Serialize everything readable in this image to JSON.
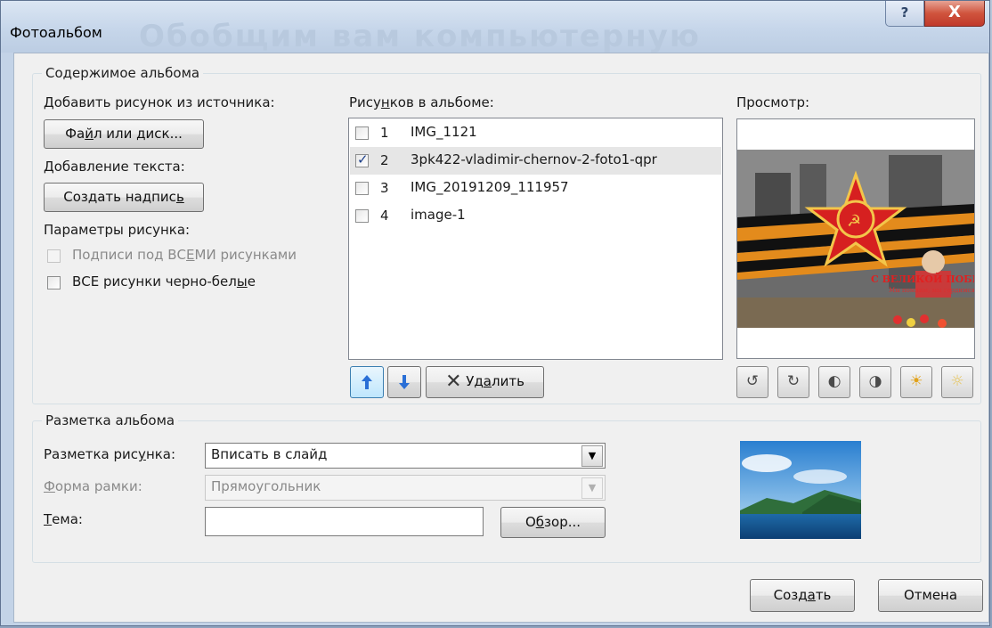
{
  "window": {
    "title": "Фотоальбом",
    "watermark": "Обобщим вам компьютерную",
    "help_label": "?",
    "close_label": "X"
  },
  "content_group": {
    "legend": "Содержимое альбома",
    "add_from_source_label": "Добавить рисунок из источника:",
    "file_button": {
      "pre": "Фа",
      "u": "й",
      "post": "л или диск..."
    },
    "add_text_label": "Добавление текста:",
    "textbox_button": {
      "pre": "Создать надпис",
      "u": "ь",
      "post": ""
    },
    "picture_options_label": "Параметры рисунка:",
    "captions_checkbox": {
      "pre": "Подписи под ВС",
      "u": "Е",
      "post": "МИ рисунками",
      "checked": false,
      "enabled": false
    },
    "bw_checkbox": {
      "pre": "ВСЕ рисунки черно-бел",
      "u": "ы",
      "post": "е",
      "checked": false,
      "enabled": true
    }
  },
  "pictures": {
    "label": {
      "pre": "Рису",
      "u": "н",
      "post": "ков в альбоме:"
    },
    "items": [
      {
        "num": "1",
        "name": "IMG_1121",
        "checked": false
      },
      {
        "num": "2",
        "name": "3pk422-vladimir-chernov-2-foto1-qpr",
        "checked": true
      },
      {
        "num": "3",
        "name": "IMG_20191209_111957",
        "checked": false
      },
      {
        "num": "4",
        "name": "image-1",
        "checked": false
      }
    ],
    "up_icon": "arrow-up-icon",
    "down_icon": "arrow-down-icon",
    "delete_button": {
      "pre": "Уд",
      "u": "а",
      "post": "лить"
    }
  },
  "preview": {
    "label": "Просмотр:",
    "banner_text": "С ВЕЛИКОЙ ПОБЕДОЙ!",
    "banner_subtext": "Мы помним, мы гордимся",
    "tool_icons": [
      "rotate-left-icon",
      "rotate-right-icon",
      "contrast-up-icon",
      "contrast-down-icon",
      "brightness-up-icon",
      "brightness-down-icon"
    ]
  },
  "layout_group": {
    "legend": "Разметка альбома",
    "picture_layout_label": {
      "pre": "Разметка рис",
      "u": "у",
      "post": "нка:"
    },
    "picture_layout_value": "Вписать в слайд",
    "frame_shape_label": {
      "pre": "",
      "u": "Ф",
      "post": "орма рамки:"
    },
    "frame_shape_value": "Прямоугольник",
    "theme_label": {
      "pre": "",
      "u": "Т",
      "post": "ема:"
    },
    "theme_value": "",
    "browse_button": {
      "pre": "О",
      "u": "б",
      "post": "зор..."
    }
  },
  "footer": {
    "create_button": {
      "pre": "Созд",
      "u": "а",
      "post": "ть"
    },
    "cancel_button": "Отмена"
  },
  "colors": {
    "titlebar": "#c6d6ea",
    "close_button": "#c0392b",
    "dialog_bg": "#f0f0f0",
    "selection": "#e6e6e6",
    "accent": "#1c3f8a"
  }
}
